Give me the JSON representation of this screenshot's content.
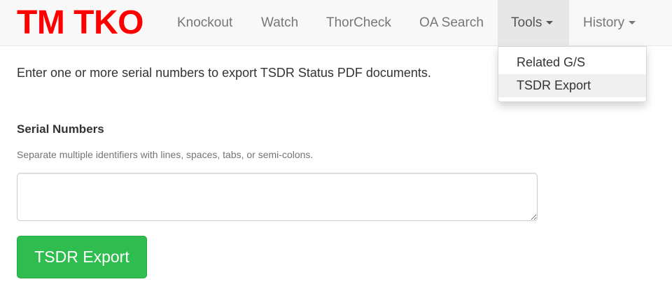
{
  "brand": {
    "text": "TM TKO",
    "color": "#ff0000"
  },
  "nav": {
    "items": [
      {
        "label": "Knockout"
      },
      {
        "label": "Watch"
      },
      {
        "label": "ThorCheck"
      },
      {
        "label": "OA Search"
      },
      {
        "label": "Tools",
        "dropdown": true,
        "open": true
      },
      {
        "label": "History",
        "dropdown": true,
        "open": false
      }
    ]
  },
  "tools_menu": {
    "items": [
      {
        "label": "Related G/S",
        "active": false
      },
      {
        "label": "TSDR Export",
        "active": true
      }
    ]
  },
  "main": {
    "intro": "Enter one or more serial numbers to export TSDR Status PDF documents.",
    "serials": {
      "label": "Serial Numbers",
      "help": "Separate multiple identifiers with lines, spaces, tabs, or semi-colons.",
      "value": ""
    },
    "export_button": {
      "label": "TSDR Export",
      "color": "#2ebd4e"
    }
  }
}
